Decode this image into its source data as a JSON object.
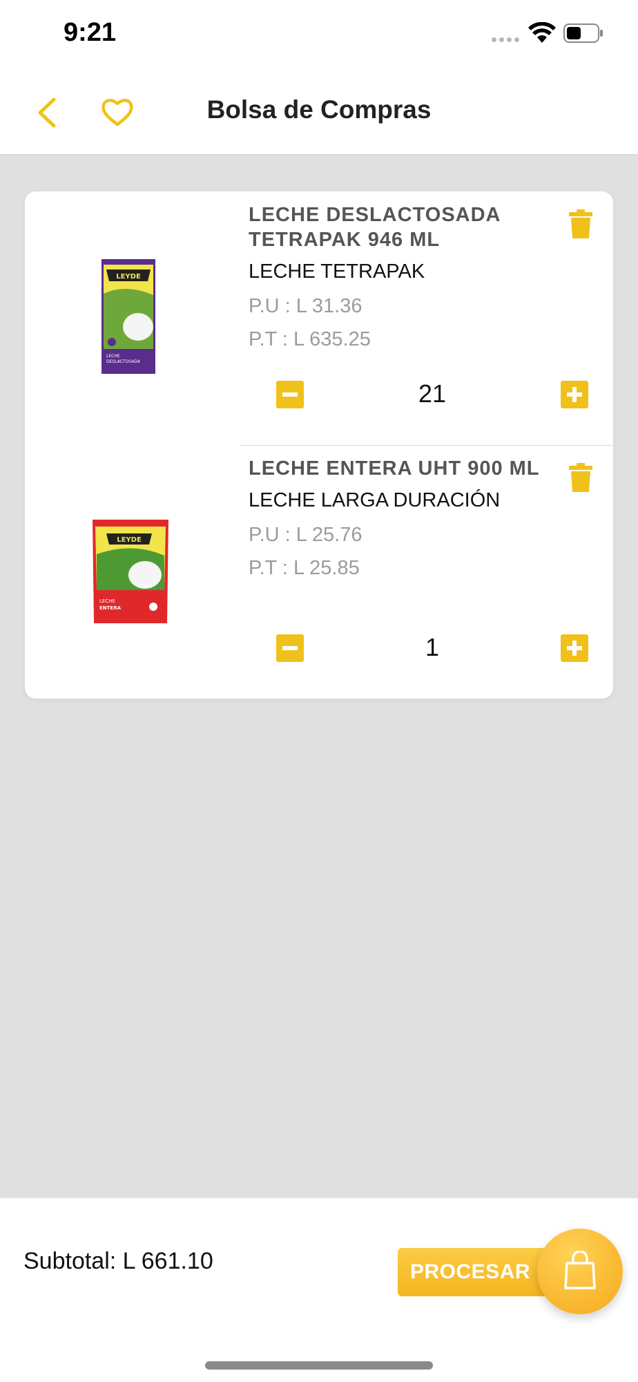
{
  "status_bar": {
    "time": "9:21"
  },
  "header": {
    "title": "Bolsa de Compras"
  },
  "cart": {
    "items": [
      {
        "name": "LECHE DESLACTOSADA TETRAPAK 946 ML",
        "category": "LECHE TETRAPAK",
        "unit_price": "P.U : L 31.36",
        "total_price": "P.T : L 635.25",
        "quantity": "21",
        "image_brand": "LEYDE",
        "image_text": "LECHE DESLACTOSADA"
      },
      {
        "name": "LECHE ENTERA UHT 900 ML",
        "category": "LECHE LARGA DURACIÓN",
        "unit_price": "P.U : L 25.76",
        "total_price": "P.T : L 25.85",
        "quantity": "1",
        "image_brand": "LEYDE",
        "image_text": "LECHE ENTERA"
      }
    ]
  },
  "footer": {
    "subtotal": "Subtotal: L 661.10",
    "process_label": "PROCESAR"
  },
  "icons": {
    "back": "chevron-left-icon",
    "favorite": "heart-icon",
    "delete": "trash-icon",
    "decrease": "minus-icon",
    "increase": "plus-icon",
    "checkout": "shopping-bag-icon"
  },
  "colors": {
    "accent": "#f0c11a",
    "background": "#e0e0e0"
  }
}
